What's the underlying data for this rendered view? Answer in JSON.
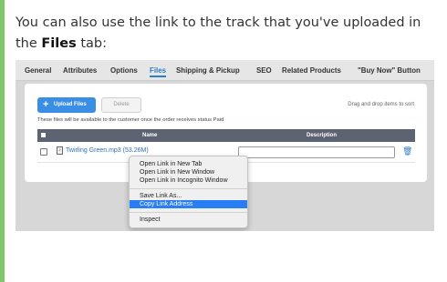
{
  "intro": {
    "before": "You can also use the link to the track that you've uploaded in the ",
    "bold": "Files",
    "after": " tab:"
  },
  "tabs": [
    "General",
    "Attributes",
    "Options",
    "Files",
    "Shipping & Pickup",
    "SEO",
    "Related Products",
    "\"Buy Now\" Button"
  ],
  "active_tab": "Files",
  "toolbar": {
    "upload_label": "Upload Files",
    "delete_label": "Delete",
    "drag_hint": "Drag and drop items to sort"
  },
  "availability_note": "These files will be available to the customer once the order receives status Paid",
  "table": {
    "headers": {
      "name": "Name",
      "description": "Description"
    },
    "rows": [
      {
        "file_name": "Twirling Green.mp3 (53.26M)",
        "description": ""
      }
    ]
  },
  "context_menu": {
    "items": [
      "Open Link in New Tab",
      "Open Link in New Window",
      "Open Link in Incognito Window",
      "Save Link As...",
      "Copy Link Address",
      "Inspect"
    ],
    "highlighted": "Copy Link Address"
  },
  "colors": {
    "accent_green": "#7ec76a",
    "link_blue": "#2f7dc2",
    "upload_button": "#3a8ee6",
    "header_gray": "#5b6470",
    "menu_highlight": "#2a7ef5"
  },
  "icons": [
    "plus-icon",
    "file-icon",
    "trash-icon",
    "checkbox-icon"
  ]
}
